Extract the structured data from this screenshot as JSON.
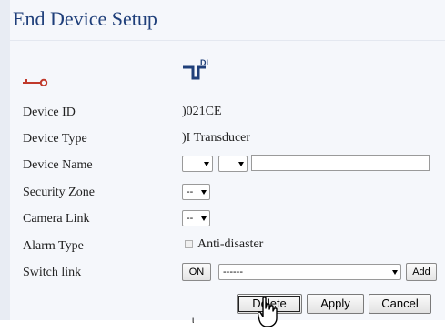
{
  "page": {
    "title": "End Device Setup"
  },
  "icons": {
    "key_icon": "key-icon",
    "device_icon": "di-transducer-icon",
    "device_icon_text": "DI",
    "cursor": "hand-pointer-cursor"
  },
  "colors": {
    "title": "#1f3f7a",
    "key_icon": "#c0392b",
    "panel_bg": "#f5f7fb"
  },
  "fields": {
    "device_id": {
      "label": "Device ID",
      "value": ")021CE"
    },
    "device_type": {
      "label": "Device Type",
      "value": ")I Transducer"
    },
    "device_name": {
      "label": "Device Name",
      "value": ""
    },
    "security_zone": {
      "label": "Security Zone",
      "selected": "--"
    },
    "camera_link": {
      "label": "Camera Link",
      "selected": "--"
    },
    "alarm_type": {
      "label": "Alarm Type",
      "option": "Anti-disaster",
      "checked": false
    },
    "switch_link": {
      "label": "Switch link",
      "on_label": "ON",
      "selected": "------",
      "add_label": "Add"
    }
  },
  "buttons": {
    "delete": "Delete",
    "apply": "Apply",
    "cancel": "Cancel"
  },
  "footer": {
    "partial_text": "ι"
  }
}
